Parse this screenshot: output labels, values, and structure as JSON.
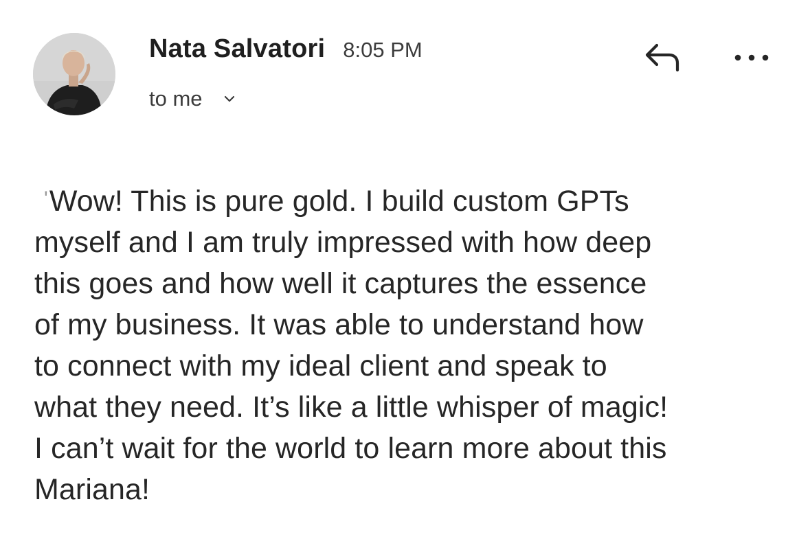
{
  "message": {
    "sender_name": "Nata Salvatori",
    "time": "8:05 PM",
    "recipient_label": "to me",
    "body_lines": [
      "Wow! This is pure gold. I build custom GPTs",
      "myself and I am truly impressed with how deep",
      "this goes and how well it captures the essence",
      "of my business. It was able to understand how",
      "to connect with my ideal client and speak to",
      "what they need. It’s like a little whisper of magic!",
      "I can’t wait for the world to learn more about this",
      "Mariana!"
    ]
  },
  "icons": {
    "avatar": "avatar",
    "recipient_toggle": "chevron-down-icon",
    "reply": "reply-icon",
    "more": "more-options-icon"
  },
  "colors": {
    "text": "#262626",
    "meta": "#3c3c3c",
    "background": "#ffffff"
  }
}
